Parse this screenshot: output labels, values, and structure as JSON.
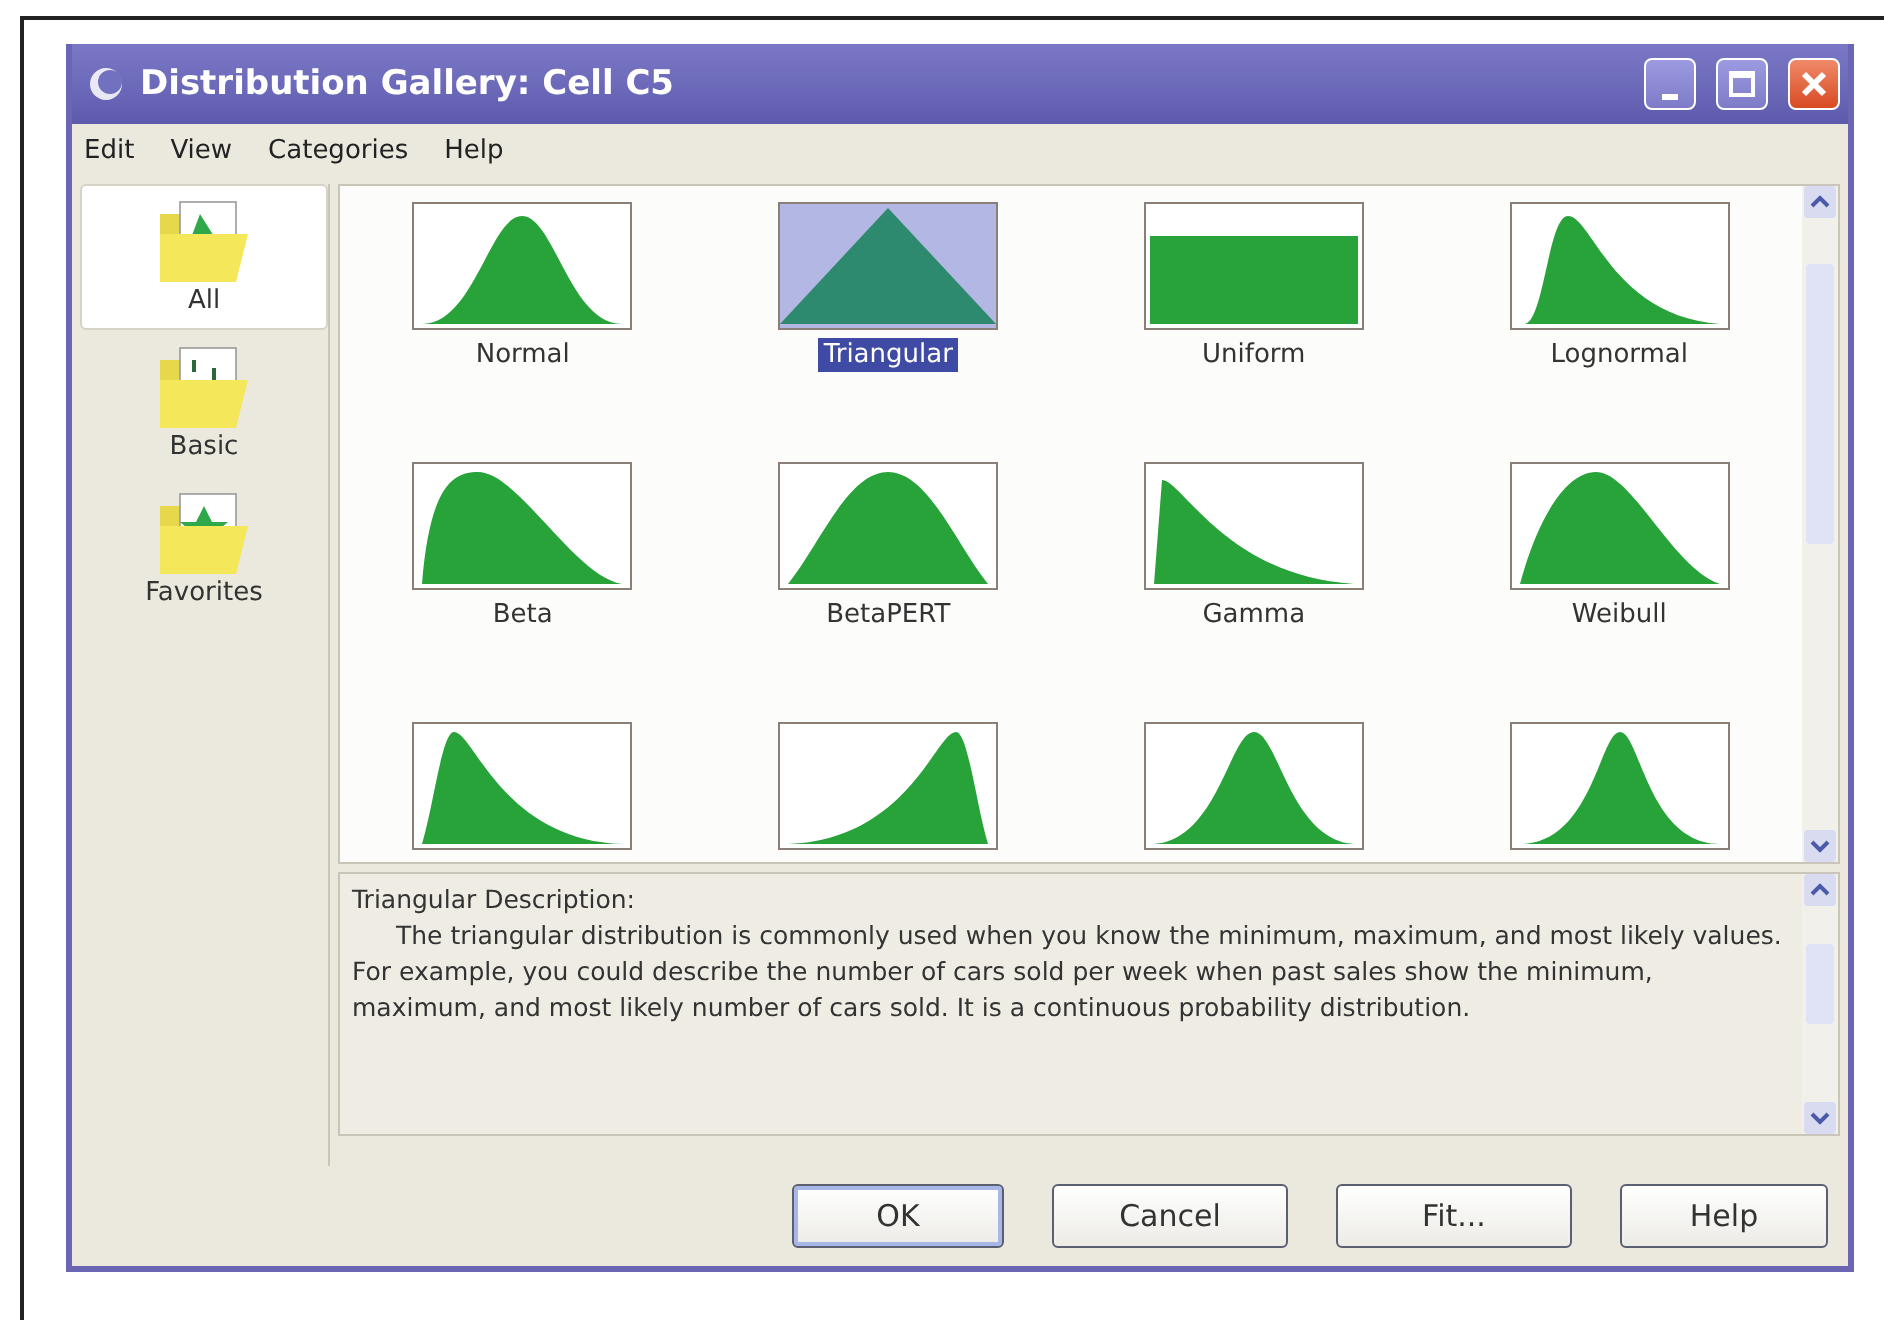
{
  "window": {
    "title": "Distribution Gallery: Cell C5"
  },
  "menu": [
    "Edit",
    "View",
    "Categories",
    "Help"
  ],
  "sidebar": {
    "items": [
      {
        "label": "All",
        "selected": true,
        "kind": "all"
      },
      {
        "label": "Basic",
        "selected": false,
        "kind": "basic"
      },
      {
        "label": "Favorites",
        "selected": false,
        "kind": "favorites"
      }
    ]
  },
  "gallery": {
    "items": [
      {
        "label": "Normal",
        "kind": "normal",
        "selected": false
      },
      {
        "label": "Triangular",
        "kind": "triangle",
        "selected": true
      },
      {
        "label": "Uniform",
        "kind": "uniform",
        "selected": false
      },
      {
        "label": "Lognormal",
        "kind": "lognormal",
        "selected": false
      },
      {
        "label": "Beta",
        "kind": "beta",
        "selected": false
      },
      {
        "label": "BetaPERT",
        "kind": "betapert",
        "selected": false
      },
      {
        "label": "Gamma",
        "kind": "gamma",
        "selected": false
      },
      {
        "label": "Weibull",
        "kind": "weibull",
        "selected": false
      },
      {
        "kind": "rightskew",
        "selected": false
      },
      {
        "kind": "leftskew",
        "selected": false
      },
      {
        "kind": "logistic",
        "selected": false
      },
      {
        "kind": "narrow",
        "selected": false
      }
    ]
  },
  "description": {
    "title": "Triangular Description:",
    "text": "The triangular distribution is commonly used when you know the minimum, maximum, and most likely values. For example, you could describe the number of cars sold per week when past sales show the minimum, maximum, and most likely number of cars sold. It is a continuous probability distribution."
  },
  "buttons": [
    "OK",
    "Cancel",
    "Fit...",
    "Help"
  ]
}
